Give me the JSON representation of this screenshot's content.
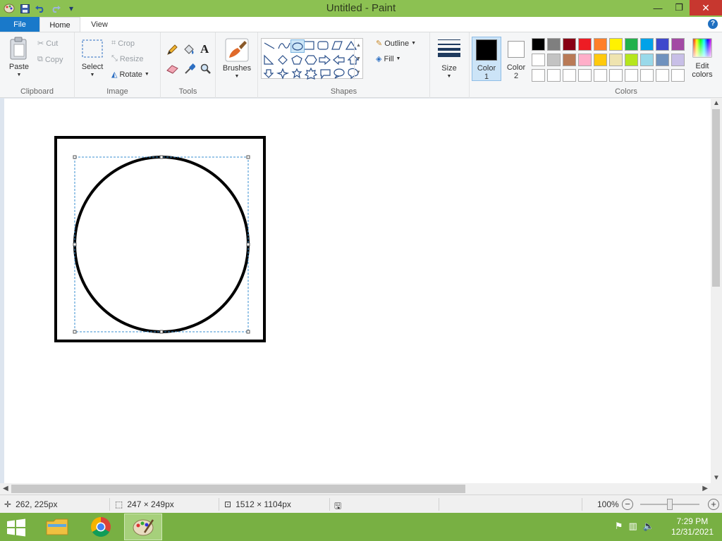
{
  "window": {
    "title": "Untitled - Paint",
    "controls": {
      "minimize": "—",
      "maximize": "❐",
      "close": "✕"
    }
  },
  "quick_access": {
    "customize": "▾"
  },
  "tabs": [
    {
      "label": "File"
    },
    {
      "label": "Home"
    },
    {
      "label": "View"
    }
  ],
  "help_label": "?",
  "clipboard": {
    "group_label": "Clipboard",
    "paste": "Paste",
    "cut": "Cut",
    "copy": "Copy"
  },
  "image": {
    "group_label": "Image",
    "select": "Select",
    "crop": "Crop",
    "resize": "Resize",
    "rotate": "Rotate"
  },
  "tools": {
    "group_label": "Tools",
    "text_glyph": "A"
  },
  "brushes": {
    "label": "Brushes"
  },
  "shapes": {
    "group_label": "Shapes",
    "outline": "Outline",
    "fill": "Fill"
  },
  "size": {
    "label": "Size"
  },
  "color1": {
    "line1": "Color",
    "line2": "1",
    "value": "#000000"
  },
  "color2": {
    "line1": "Color",
    "line2": "2",
    "value": "#ffffff"
  },
  "colors": {
    "group_label": "Colors",
    "edit_line1": "Edit",
    "edit_line2": "colors",
    "palette_row1": [
      "#000000",
      "#7f7f7f",
      "#880015",
      "#ed1c24",
      "#ff7f27",
      "#fff200",
      "#22b14c",
      "#00a2e8",
      "#3f48cc",
      "#a349a4"
    ],
    "palette_row2": [
      "#ffffff",
      "#c3c3c3",
      "#b97a57",
      "#ffaec9",
      "#ffc90e",
      "#efe4b0",
      "#b5e61d",
      "#99d9ea",
      "#7092be",
      "#c8bfe7"
    ],
    "palette_row3": [
      "#ffffff",
      "#ffffff",
      "#ffffff",
      "#ffffff",
      "#ffffff",
      "#ffffff",
      "#ffffff",
      "#ffffff",
      "#ffffff",
      "#ffffff"
    ]
  },
  "status": {
    "cursor_pos": "262, 225px",
    "selection_size": "247 × 249px",
    "image_size": "1512 × 1104px",
    "zoom": "100%",
    "zoom_out": "−",
    "zoom_in": "+"
  },
  "taskbar": {
    "time": "7:29 PM",
    "date": "12/31/2021"
  }
}
